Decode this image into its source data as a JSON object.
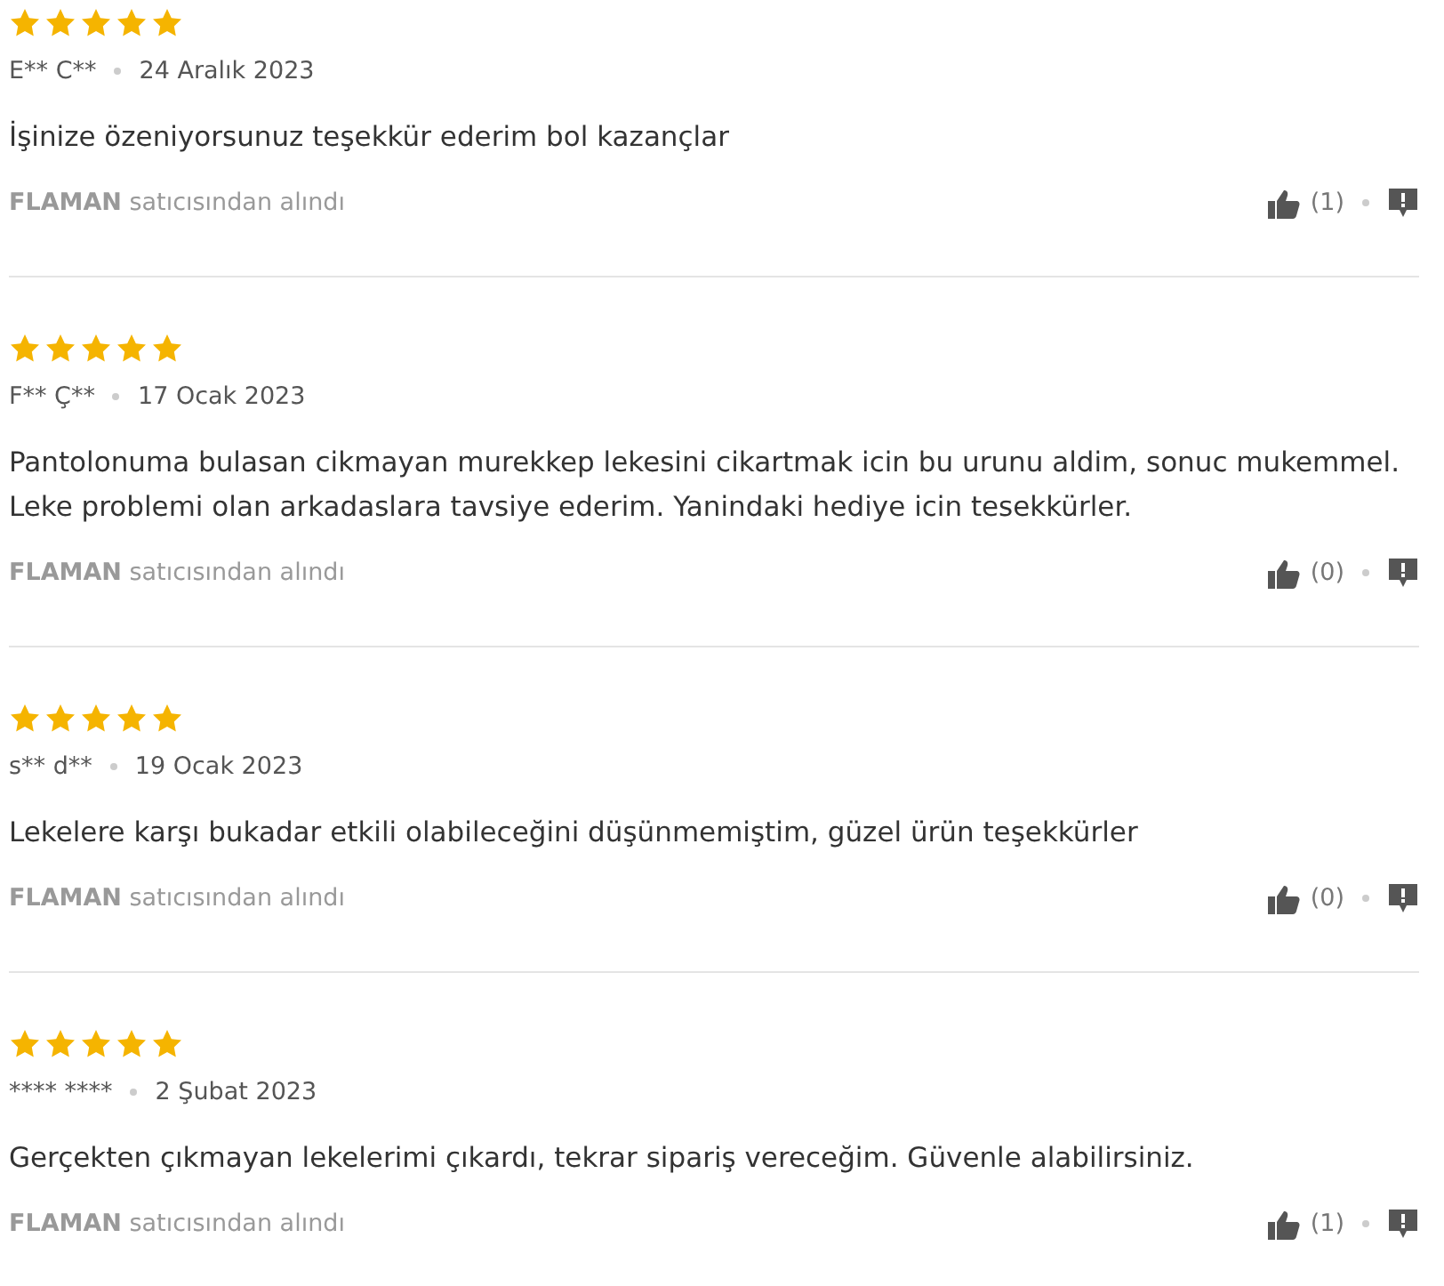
{
  "reviews": [
    {
      "stars": 5,
      "author": "E** C**",
      "date": "24 Aralık 2023",
      "text": "İşinize özeniyorsunuz teşekkür ederim bol kazançlar",
      "seller": "**FLAMAN** satıcısından alındı",
      "likes": "(1)"
    },
    {
      "stars": 5,
      "author": "F** Ç**",
      "date": "17 Ocak 2023",
      "text": "Pantolonuma bulasan cikmayan murekkep lekesini cikartmak icin bu urunu aldim, sonuc mukemmel. Leke problemi olan arkadaslara tavsiye ederim. Yanindaki hediye icin tesekkürler.",
      "seller": "**FLAMAN** satıcısından alındı",
      "likes": "(0)"
    },
    {
      "stars": 5,
      "author": "s** d**",
      "date": "19 Ocak 2023",
      "text": "Lekelere karşı bukadar etkili olabileceğini düşünmemiştim, güzel ürün teşekkürler",
      "seller": "**FLAMAN** satıcısından alındı",
      "likes": "(0)"
    },
    {
      "stars": 5,
      "author": "**** ****",
      "date": "2 Şubat 2023",
      "text": "Gerçekten çıkmayan lekelerimi çıkardı, tekrar sipariş vereceğim. Güvenle alabilirsiniz.",
      "seller": "**FLAMAN** satıcısından alındı",
      "likes": "(1)"
    }
  ]
}
